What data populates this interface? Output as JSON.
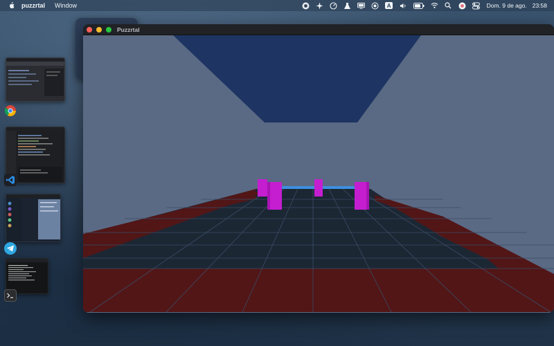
{
  "menubar": {
    "app_name": "puzzrtal",
    "menus": [
      "Window"
    ],
    "clock": {
      "date": "Dom. 9 de ago.",
      "time": "23:58"
    },
    "status_icons": [
      "app-icon",
      "sparkle-icon",
      "gauge-icon",
      "flask-icon",
      "display-icon",
      "record-icon",
      "input-source-icon",
      "volume-icon",
      "battery-icon",
      "wifi-icon",
      "spotlight-icon",
      "user-icon",
      "control-center-icon"
    ],
    "input_source_label": "A"
  },
  "stage_manager": {
    "apps": [
      "chrome-icon",
      "vscode-icon",
      "telegram-icon",
      "terminal-icon"
    ]
  },
  "window": {
    "title": "Puzzrtal",
    "traffic_colors": [
      "#fe5f57",
      "#febc2e",
      "#28c840"
    ]
  },
  "scene": {
    "colors": {
      "wall": "#5a6a84",
      "ceiling": "#1e3563",
      "floor": "#1c2734",
      "floor_red": "#521617",
      "grid": "#3a4d66",
      "pillars": "#c41ed0",
      "bar": "#3c8fe0"
    }
  }
}
